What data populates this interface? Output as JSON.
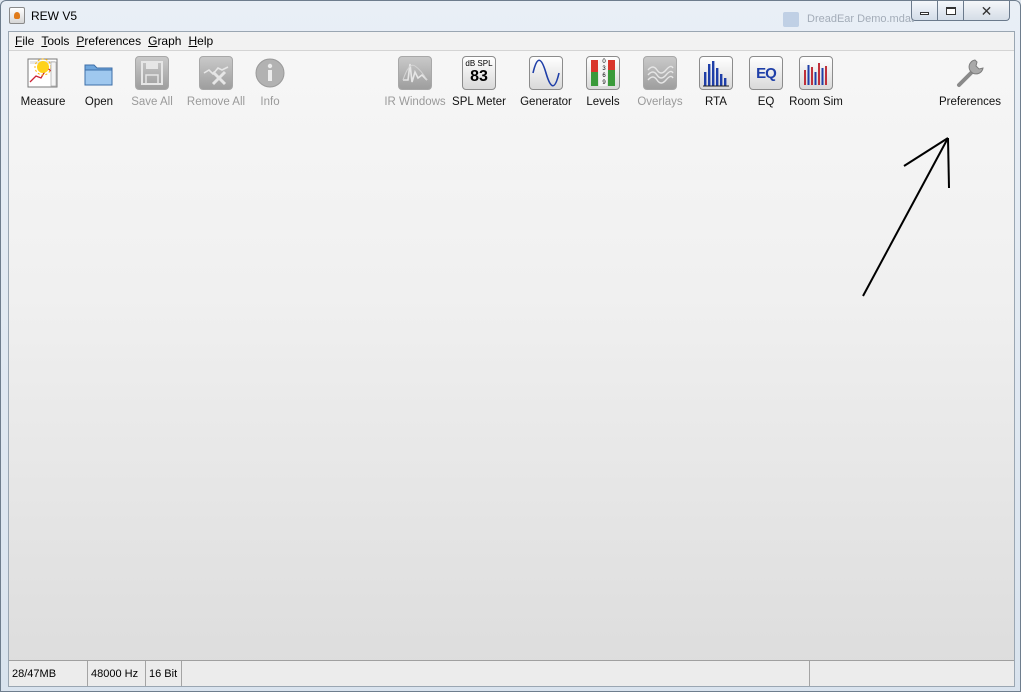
{
  "window": {
    "title": "REW V5",
    "background_tab_text": "DreadEar Demo.mdat"
  },
  "menubar": {
    "items": [
      "File",
      "Tools",
      "Preferences",
      "Graph",
      "Help"
    ]
  },
  "toolbar": {
    "measure": "Measure",
    "open": "Open",
    "save_all": "Save All",
    "remove_all": "Remove All",
    "info": "Info",
    "ir_windows": "IR Windows",
    "spl_meter": "SPL Meter",
    "spl_meter_icon_top": "dB SPL",
    "spl_meter_icon_value": "83",
    "generator": "Generator",
    "levels": "Levels",
    "levels_scale": "0 3 6 9",
    "overlays": "Overlays",
    "rta": "RTA",
    "eq": "EQ",
    "eq_icon_text": "EQ",
    "room_sim": "Room Sim",
    "preferences": "Preferences"
  },
  "statusbar": {
    "memory": "28/47MB",
    "sample_rate": "48000 Hz",
    "bit_depth": "16 Bit"
  },
  "colors": {
    "accent_blue": "#1f3fa8",
    "levels_red": "#d9352b",
    "levels_green": "#3a9a3a",
    "room_sim_red": "#c0303a"
  }
}
